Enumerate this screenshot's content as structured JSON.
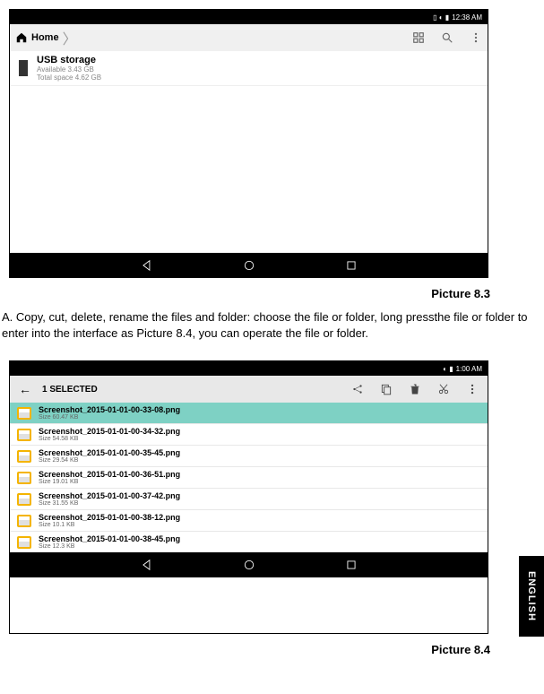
{
  "screenshot1": {
    "status": {
      "icons": "▯ ◐ ▮",
      "time": "12:38 AM"
    },
    "breadcrumb": {
      "home": "Home"
    },
    "storage": {
      "title": "USB storage",
      "available": "Available 3.43 GB",
      "total": "Total space 4.62 GB"
    },
    "caption": "Picture 8.3"
  },
  "body_text": "A. Copy, cut, delete, rename the files and folder: choose the file or folder, long pressthe file or folder to enter into the interface as Picture 8.4, you can operate the file or folder.",
  "screenshot2": {
    "status": {
      "icons": "◐ ▮",
      "time": "1:00 AM"
    },
    "selection": {
      "back": "←",
      "count": "1 SELECTED"
    },
    "files": [
      {
        "name": "Screenshot_2015-01-01-00-33-08.png",
        "size": "Size 60.47 KB",
        "selected": true
      },
      {
        "name": "Screenshot_2015-01-01-00-34-32.png",
        "size": "Size 54.58 KB",
        "selected": false
      },
      {
        "name": "Screenshot_2015-01-01-00-35-45.png",
        "size": "Size 29.54 KB",
        "selected": false
      },
      {
        "name": "Screenshot_2015-01-01-00-36-51.png",
        "size": "Size 19.01 KB",
        "selected": false
      },
      {
        "name": "Screenshot_2015-01-01-00-37-42.png",
        "size": "Size 31.55 KB",
        "selected": false
      },
      {
        "name": "Screenshot_2015-01-01-00-38-12.png",
        "size": "Size 10.1 KB",
        "selected": false
      },
      {
        "name": "Screenshot_2015-01-01-00-38-45.png",
        "size": "Size 12.3 KB",
        "selected": false
      }
    ],
    "caption": "Picture 8.4"
  },
  "side_tab": "ENGLISH"
}
